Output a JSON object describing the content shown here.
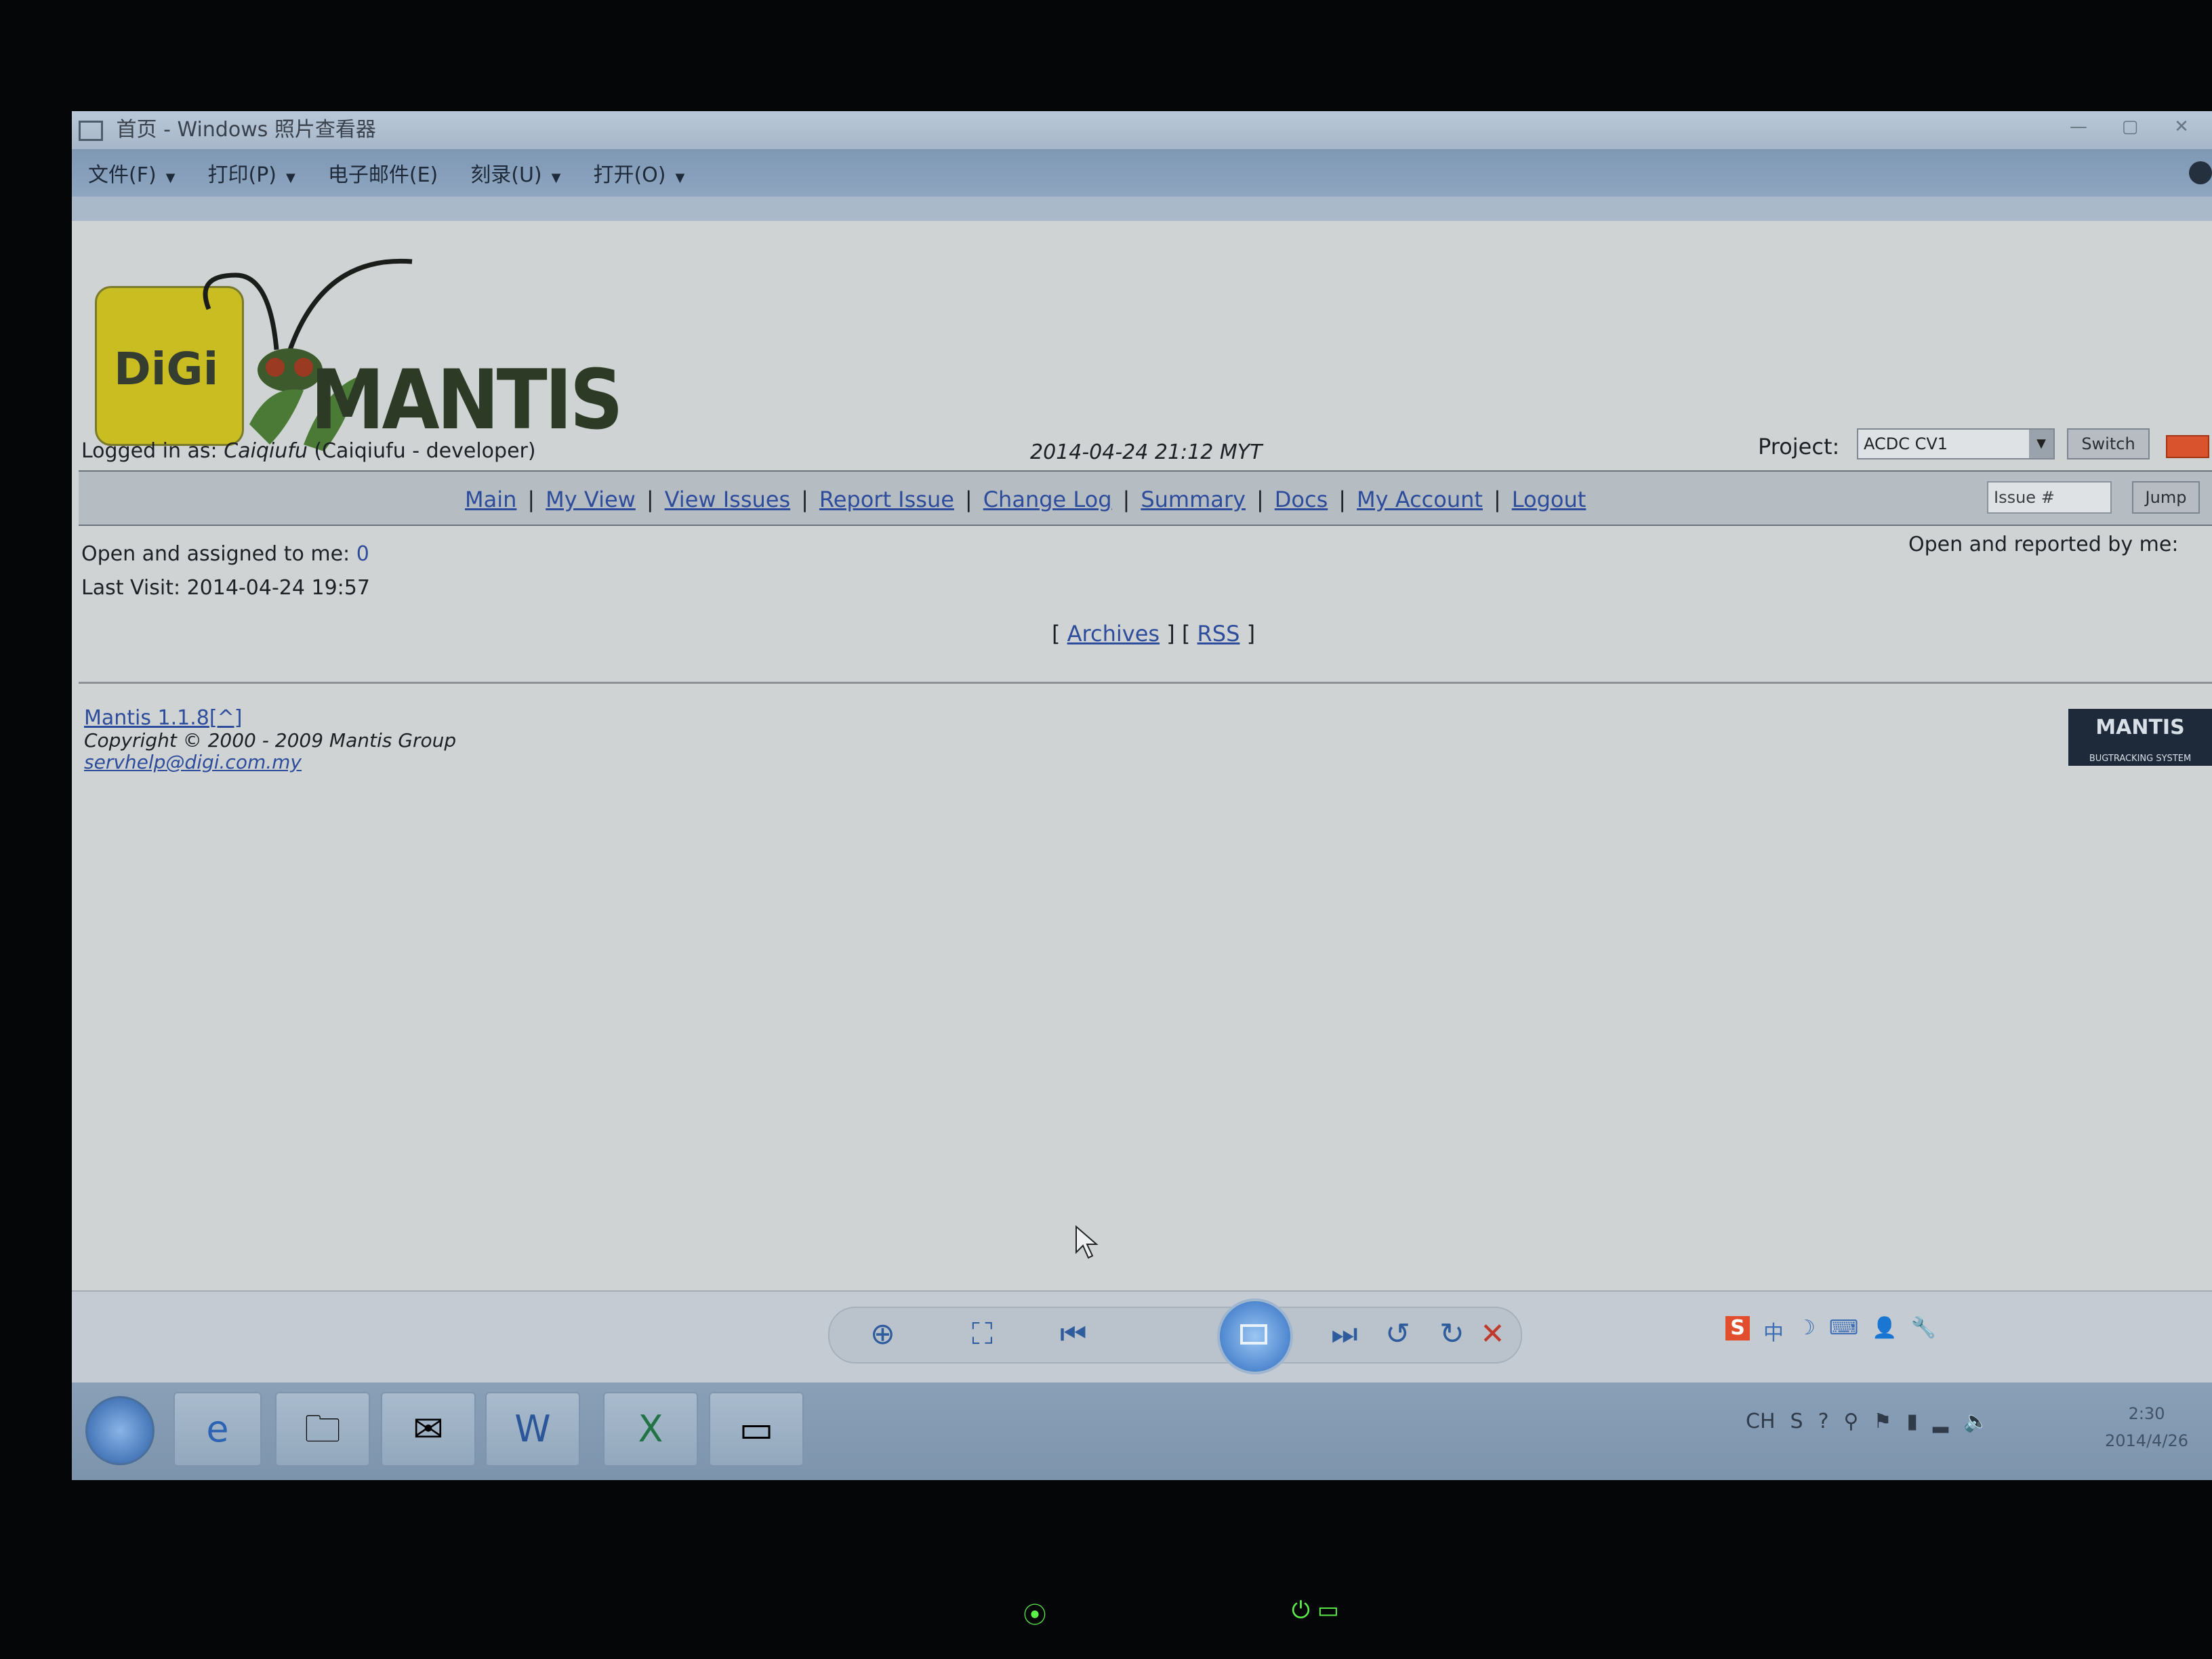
{
  "window": {
    "title": "首页 - Windows 照片查看器",
    "controls": [
      "—",
      "▢",
      "✕"
    ]
  },
  "menu": {
    "items": [
      {
        "label": "文件(F)",
        "has_caret": true
      },
      {
        "label": "打印(P)",
        "has_caret": true
      },
      {
        "label": "电子邮件(E)",
        "has_caret": false
      },
      {
        "label": "刻录(U)",
        "has_caret": true
      },
      {
        "label": "打开(O)",
        "has_caret": true
      }
    ]
  },
  "header": {
    "logo_text_digi": "DiGi",
    "logo_text_mantis": "MANTIS",
    "logged_in_label": "Logged in as: ",
    "logged_in_user": "Caiqiufu",
    "logged_in_detail": " (Caiqiufu - developer)",
    "datetime": "2014-04-24 21:12 MYT",
    "project_label": "Project:",
    "project_value": "ACDC CV1",
    "switch_label": "Switch"
  },
  "nav": {
    "links": [
      "Main",
      "My View",
      "View Issues",
      "Report Issue",
      "Change Log",
      "Summary",
      "Docs",
      "My Account",
      "Logout"
    ],
    "issue_placeholder": "Issue #",
    "jump_label": "Jump"
  },
  "main": {
    "assigned_label": "Open and assigned to me: ",
    "assigned_count": "0",
    "reported_label": "Open and reported by me: ",
    "last_visit": "Last Visit: 2014-04-24 19:57",
    "archives": "Archives",
    "rss": "RSS"
  },
  "footer": {
    "version": "Mantis 1.1.8",
    "version_suffix": "[^]",
    "copyright": "Copyright © 2000 - 2009 Mantis Group",
    "email": "servhelp@digi.com.my",
    "badge_title": "MANTIS",
    "badge_sub": "BUGTRACKING SYSTEM"
  },
  "taskbar": {
    "tray_lang": "CH",
    "clock_time": "2:30",
    "clock_date": "2014/4/26"
  },
  "colors": {
    "link": "#2d4c9b",
    "logo_yellow": "#c9bd22",
    "close_red": "#c0392b"
  }
}
